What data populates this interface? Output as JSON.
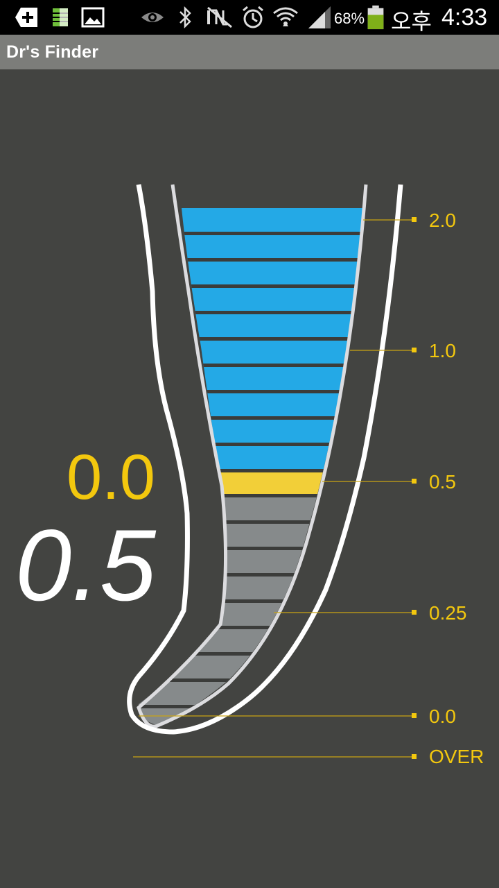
{
  "status_bar": {
    "icons_left": [
      "add-notification-icon",
      "sd-card-icon",
      "gallery-icon"
    ],
    "icons_right": [
      "eye-icon",
      "bluetooth-icon",
      "mute-icon",
      "alarm-icon",
      "wifi-icon",
      "signal-icon",
      "battery-icon"
    ],
    "battery_percent": "68%",
    "battery_level": 0.68,
    "ampm": "오후",
    "time": "4:33",
    "colors": {
      "battery": "#7fb019"
    }
  },
  "app": {
    "title": "Dr's Finder"
  },
  "gauge": {
    "current_value": "0.0",
    "selected_value": "0.5",
    "scale_labels": [
      "2.0",
      "1.0",
      "0.5",
      "0.25",
      "0.0",
      "OVER"
    ],
    "colors": {
      "background": "#434441",
      "blue_segments": "#24a9e6",
      "highlight_segment": "#f2cf38",
      "gray_segments": "#868a8b",
      "separator": "#3b3c3a",
      "accent": "#f3c80e",
      "outline": "#ffffff"
    }
  }
}
